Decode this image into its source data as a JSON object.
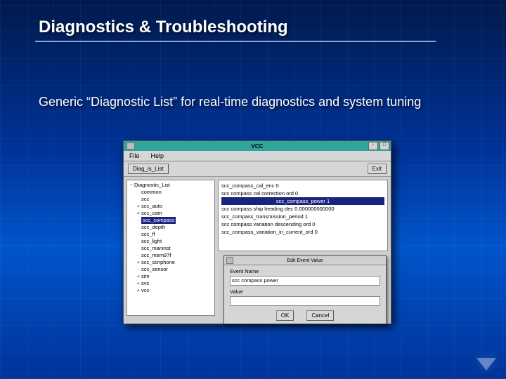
{
  "slide": {
    "title": "Diagnostics & Troubleshooting",
    "subtitle": "Generic “Diagnostic List” for real-time diagnostics and system tuning"
  },
  "app": {
    "window_title": "VCC",
    "menu": {
      "file": "File",
      "help": "Help"
    },
    "toolbar": {
      "diag_btn": "Diag_is_List",
      "exit_btn": "Exit"
    },
    "tree": {
      "root": "Diagnostic_List",
      "items": [
        {
          "label": "common"
        },
        {
          "label": "scc"
        },
        {
          "label": "scc_auto",
          "exp": "+"
        },
        {
          "label": "scc_cam",
          "exp": "+"
        },
        {
          "label": "scc_compass",
          "selected": true
        },
        {
          "label": "scc_depth"
        },
        {
          "label": "scc_ff"
        },
        {
          "label": "scc_light"
        },
        {
          "label": "scc_maninst"
        },
        {
          "label": "scc_mem97f"
        },
        {
          "label": "scc_scnphone",
          "exp": "+"
        },
        {
          "label": "scc_sensor"
        },
        {
          "label": "sim",
          "exp": "+"
        },
        {
          "label": "svc",
          "exp": "+"
        },
        {
          "label": "vcc",
          "exp": "+"
        }
      ]
    },
    "list": {
      "rows": [
        "scc_compass_cal_enc 0",
        "scc compass cal correction ord 0",
        "scc_compass_power 1",
        "scc compass ship heading dec 0.000000000000",
        "scc_compass_transmission_period 1",
        "scc compass variation descending ord 0",
        "scc_compass_variation_in_current_ord 0"
      ],
      "selected_index": 2
    },
    "dialog": {
      "title": "Edit Event Value",
      "name_label": "Event Name",
      "name_value": "scc compass power",
      "value_label": "Value",
      "value_value": "",
      "ok": "OK",
      "cancel": "Cancel"
    }
  }
}
